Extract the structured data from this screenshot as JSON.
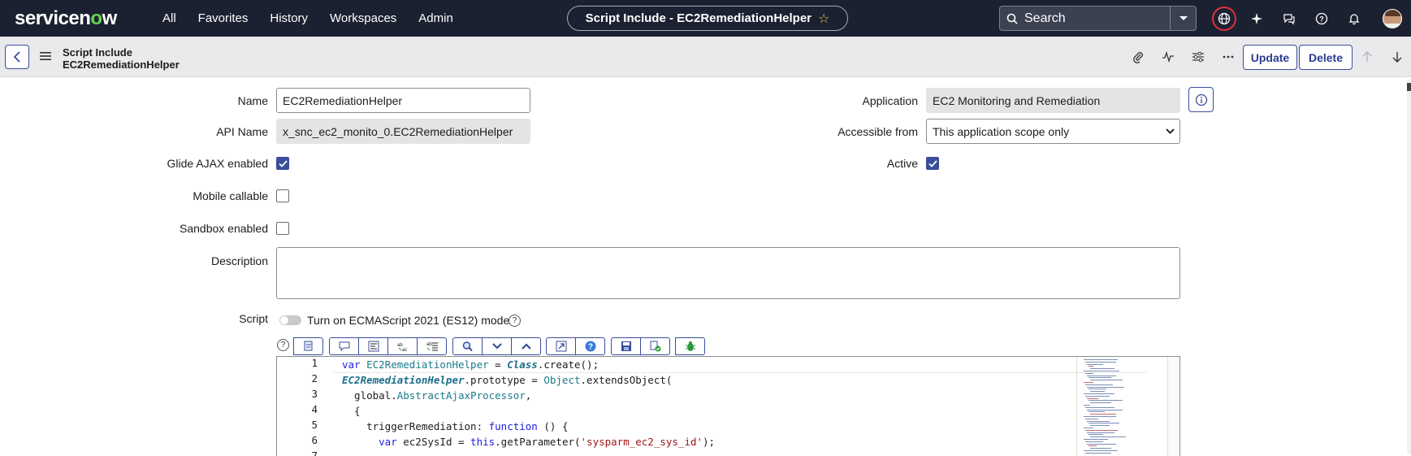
{
  "topnav": {
    "logo": "servicenow",
    "menu": [
      "All",
      "Favorites",
      "History",
      "Workspaces",
      "Admin"
    ],
    "record_title": "Script Include - EC2RemediationHelper",
    "search_placeholder": "Search"
  },
  "header": {
    "type": "Script Include",
    "name": "EC2RemediationHelper",
    "update_label": "Update",
    "delete_label": "Delete"
  },
  "form": {
    "name_label": "Name",
    "name_value": "EC2RemediationHelper",
    "api_name_label": "API Name",
    "api_name_value": "x_snc_ec2_monito_0.EC2RemediationHelper",
    "glide_ajax_label": "Glide AJAX enabled",
    "glide_ajax_checked": true,
    "mobile_callable_label": "Mobile callable",
    "mobile_callable_checked": false,
    "sandbox_label": "Sandbox enabled",
    "sandbox_checked": false,
    "description_label": "Description",
    "description_value": "",
    "application_label": "Application",
    "application_value": "EC2 Monitoring and Remediation",
    "accessible_label": "Accessible from",
    "accessible_value": "This application scope only",
    "active_label": "Active",
    "active_checked": true,
    "script_label": "Script",
    "es12_toggle_label": "Turn on ECMAScript 2021 (ES12) mode"
  },
  "toolbar_icons": [
    "toggle-syntax-icon",
    "comment-icon",
    "format-icon",
    "replace-icon",
    "replace-all-icon",
    "search-icon",
    "next-icon",
    "previous-icon",
    "fullscreen-icon",
    "help-icon",
    "save-icon",
    "check-syntax-icon",
    "debug-icon"
  ],
  "code": {
    "line_numbers": [
      "1",
      "2",
      "3",
      "4",
      "5",
      "6",
      "7"
    ]
  },
  "colors": {
    "nav_bg": "#1b2130",
    "brand_green": "#62d84e",
    "accent": "#3a4e9b",
    "globe_ring": "#e0303c"
  }
}
